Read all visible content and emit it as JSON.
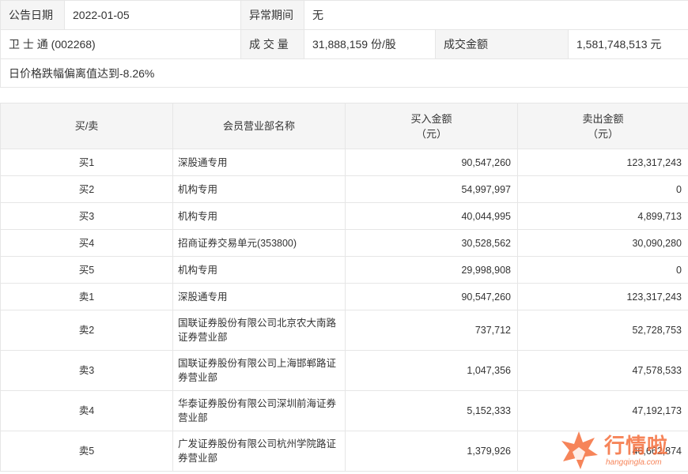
{
  "info": {
    "announce_date_label": "公告日期",
    "announce_date_value": "2022-01-05",
    "abnormal_period_label": "异常期间",
    "abnormal_period_value": "无",
    "stock_name": "卫 士 通 (002268)",
    "volume_label": "成 交 量",
    "volume_value": "31,888,159 份/股",
    "turnover_label": "成交金额",
    "turnover_value": "1,581,748,513 元",
    "reason": "日价格跌幅偏离值达到-8.26%"
  },
  "table": {
    "headers": {
      "side": "买/卖",
      "dept": "会员营业部名称",
      "buy_line1": "买入金额",
      "buy_line2": "（元）",
      "sell_line1": "卖出金额",
      "sell_line2": "（元）"
    },
    "rows": [
      {
        "side": "买1",
        "dept": "深股通专用",
        "buy": "90,547,260",
        "sell": "123,317,243"
      },
      {
        "side": "买2",
        "dept": "机构专用",
        "buy": "54,997,997",
        "sell": "0"
      },
      {
        "side": "买3",
        "dept": "机构专用",
        "buy": "40,044,995",
        "sell": "4,899,713"
      },
      {
        "side": "买4",
        "dept": "招商证券交易单元(353800)",
        "buy": "30,528,562",
        "sell": "30,090,280"
      },
      {
        "side": "买5",
        "dept": "机构专用",
        "buy": "29,998,908",
        "sell": "0"
      },
      {
        "side": "卖1",
        "dept": "深股通专用",
        "buy": "90,547,260",
        "sell": "123,317,243"
      },
      {
        "side": "卖2",
        "dept": "国联证券股份有限公司北京农大南路证券营业部",
        "buy": "737,712",
        "sell": "52,728,753"
      },
      {
        "side": "卖3",
        "dept": "国联证券股份有限公司上海邯郸路证券营业部",
        "buy": "1,047,356",
        "sell": "47,578,533"
      },
      {
        "side": "卖4",
        "dept": "华泰证券股份有限公司深圳前海证券营业部",
        "buy": "5,152,333",
        "sell": "47,192,173"
      },
      {
        "side": "卖5",
        "dept": "广发证券股份有限公司杭州学院路证券营业部",
        "buy": "1,379,926",
        "sell": "46,662,874"
      }
    ]
  },
  "watermark": {
    "icon": "fox-logo-icon",
    "text": "行情啦",
    "domain": "hangqingla.com",
    "color": "#f56e3c"
  }
}
